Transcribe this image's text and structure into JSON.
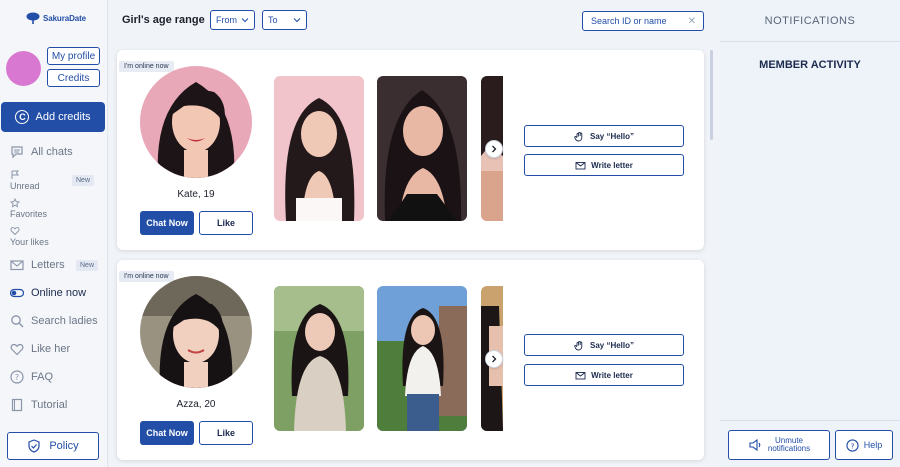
{
  "brand": {
    "name": "SakuraDate",
    "accent": "#234ea8"
  },
  "account": {
    "my_profile_label": "My profile",
    "credits_label": "Credits",
    "add_credits_label": "Add credits"
  },
  "nav": {
    "all_chats": "All chats",
    "unread": "Unread",
    "unread_badge": "New",
    "favorites": "Favorites",
    "your_likes": "Your likes",
    "letters": "Letters",
    "letters_badge": "New",
    "online_now": "Online now",
    "search_ladies": "Search ladies",
    "like_her": "Like her",
    "faq": "FAQ",
    "tutorial": "Tutorial",
    "policy": "Policy"
  },
  "filters": {
    "age_label": "Girl's age range",
    "from_value": "From",
    "to_value": "To",
    "search_placeholder": "Search ID or name"
  },
  "profiles": [
    {
      "status": "I'm online now",
      "name": "Kate, 19",
      "chat_label": "Chat Now",
      "like_label": "Like",
      "hello_label": "Say “Hello”",
      "letter_label": "Write letter"
    },
    {
      "status": "I'm online now",
      "name": "Azza, 20",
      "chat_label": "Chat Now",
      "like_label": "Like",
      "hello_label": "Say “Hello”",
      "letter_label": "Write letter"
    }
  ],
  "right_panel": {
    "notifications_title": "NOTIFICATIONS",
    "activity_title": "MEMBER ACTIVITY",
    "unmute_line1": "Unmute",
    "unmute_line2": "notifications",
    "help_label": "Help"
  }
}
